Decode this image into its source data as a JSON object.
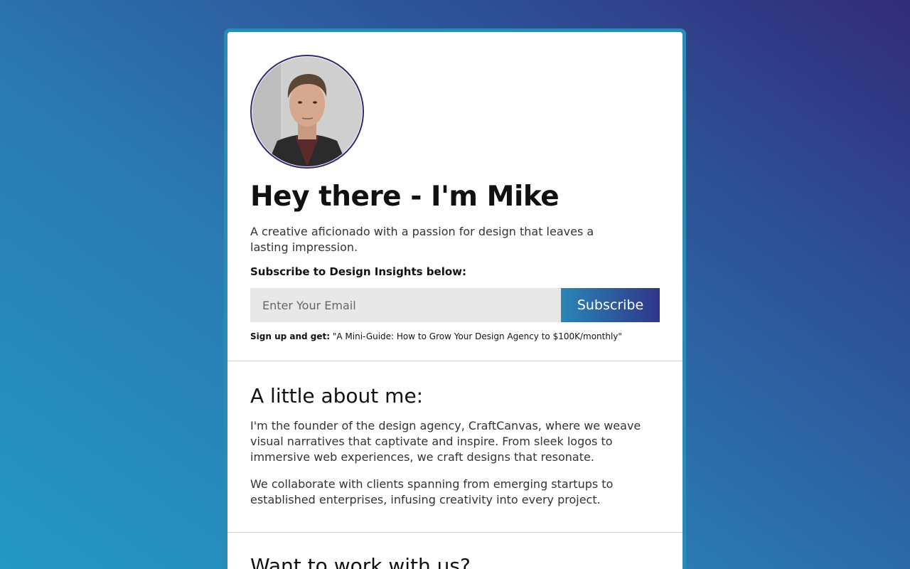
{
  "hero": {
    "title": "Hey there - I'm Mike",
    "tagline": "A creative aficionado with a passion for design that leaves a lasting impression.",
    "subscribe_label": "Subscribe to Design Insights below:",
    "email_placeholder": "Enter Your Email",
    "subscribe_button": "Subscribe",
    "signup_prefix": "Sign up and get:",
    "signup_offer": " \"A Mini-Guide: How to Grow Your Design Agency to $100K/monthly\""
  },
  "about": {
    "title": "A little about me:",
    "paragraph_1": "I'm the founder of the design agency, CraftCanvas, where we weave visual narratives that captivate and inspire. From sleek logos to immersive web experiences, we craft designs that resonate.",
    "paragraph_2": "We collaborate with clients spanning from emerging startups to established enterprises, infusing creativity into every project."
  },
  "work": {
    "title": "Want to work with us?"
  },
  "colors": {
    "accent_start": "#2a86b5",
    "accent_end": "#30358a",
    "frame": "#2a8cb5"
  }
}
